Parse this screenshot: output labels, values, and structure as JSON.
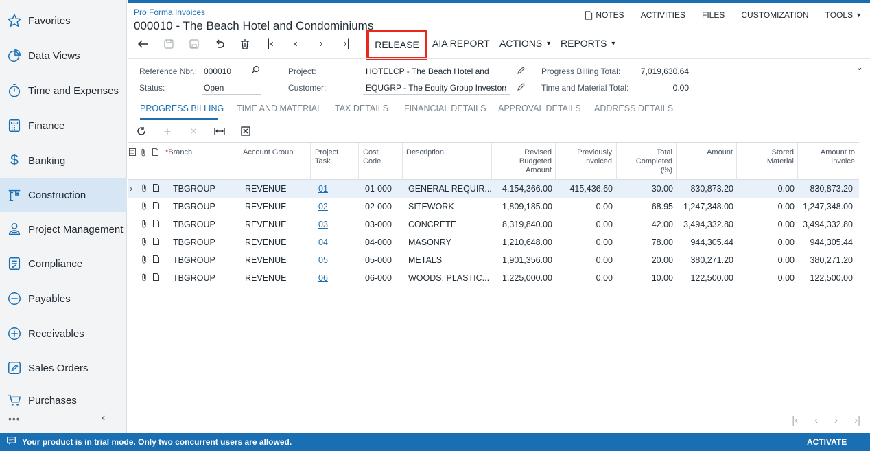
{
  "sidebar": {
    "items": [
      {
        "label": "Favorites",
        "icon": "star-icon"
      },
      {
        "label": "Data Views",
        "icon": "pie-chart-icon"
      },
      {
        "label": "Time and Expenses",
        "icon": "stopwatch-icon"
      },
      {
        "label": "Finance",
        "icon": "calculator-icon"
      },
      {
        "label": "Banking",
        "icon": "dollar-icon"
      },
      {
        "label": "Construction",
        "icon": "crane-icon"
      },
      {
        "label": "Project Management",
        "icon": "people-icon"
      },
      {
        "label": "Compliance",
        "icon": "checklist-icon"
      },
      {
        "label": "Payables",
        "icon": "minus-circle-icon"
      },
      {
        "label": "Receivables",
        "icon": "plus-circle-icon"
      },
      {
        "label": "Sales Orders",
        "icon": "edit-icon"
      },
      {
        "label": "Purchases",
        "icon": "cart-icon"
      }
    ],
    "more": "•••",
    "collapse": "‹"
  },
  "header": {
    "breadcrumb": "Pro Forma Invoices",
    "title": "000010 - The Beach Hotel and Condominiums",
    "links": {
      "notes": "NOTES",
      "activities": "ACTIVITIES",
      "files": "FILES",
      "customization": "CUSTOMIZATION",
      "tools": "TOOLS"
    }
  },
  "toolbar": {
    "release": "RELEASE",
    "aia_report": "AIA REPORT",
    "actions": "ACTIONS",
    "reports": "REPORTS"
  },
  "form": {
    "ref_label": "Reference Nbr.:",
    "ref_value": "000010",
    "status_label": "Status:",
    "status_value": "Open",
    "project_label": "Project:",
    "project_value": "HOTELCP - The Beach Hotel and Condo",
    "customer_label": "Customer:",
    "customer_value": "EQUGRP - The Equity Group Investors",
    "pb_total_label": "Progress Billing Total:",
    "pb_total_value": "7,019,630.64",
    "tm_total_label": "Time and Material Total:",
    "tm_total_value": "0.00"
  },
  "tabs": [
    "PROGRESS BILLING",
    "TIME AND MATERIAL",
    "TAX DETAILS",
    "FINANCIAL DETAILS",
    "APPROVAL DETAILS",
    "ADDRESS DETAILS"
  ],
  "grid": {
    "headers": {
      "branch": "Branch",
      "account_group": "Account Group",
      "project_task": "Project\nTask",
      "cost_code": "Cost\nCode",
      "description": "Description",
      "revised": "Revised\nBudgeted\nAmount",
      "previously": "Previously\nInvoiced",
      "total_completed": "Total\nCompleted\n(%)",
      "amount": "Amount",
      "stored": "Stored\nMaterial",
      "amount_to_invoice": "Amount to\nInvoice"
    },
    "rows": [
      {
        "branch": "TBGROUP",
        "account_group": "REVENUE",
        "task": "01",
        "cost_code": "01-000",
        "description": "GENERAL REQUIR...",
        "revised": "4,154,366.00",
        "previously": "415,436.60",
        "completed": "30.00",
        "amount": "830,873.20",
        "stored": "0.00",
        "to_invoice": "830,873.20"
      },
      {
        "branch": "TBGROUP",
        "account_group": "REVENUE",
        "task": "02",
        "cost_code": "02-000",
        "description": "SITEWORK",
        "revised": "1,809,185.00",
        "previously": "0.00",
        "completed": "68.95",
        "amount": "1,247,348.00",
        "stored": "0.00",
        "to_invoice": "1,247,348.00"
      },
      {
        "branch": "TBGROUP",
        "account_group": "REVENUE",
        "task": "03",
        "cost_code": "03-000",
        "description": "CONCRETE",
        "revised": "8,319,840.00",
        "previously": "0.00",
        "completed": "42.00",
        "amount": "3,494,332.80",
        "stored": "0.00",
        "to_invoice": "3,494,332.80"
      },
      {
        "branch": "TBGROUP",
        "account_group": "REVENUE",
        "task": "04",
        "cost_code": "04-000",
        "description": "MASONRY",
        "revised": "1,210,648.00",
        "previously": "0.00",
        "completed": "78.00",
        "amount": "944,305.44",
        "stored": "0.00",
        "to_invoice": "944,305.44"
      },
      {
        "branch": "TBGROUP",
        "account_group": "REVENUE",
        "task": "05",
        "cost_code": "05-000",
        "description": "METALS",
        "revised": "1,901,356.00",
        "previously": "0.00",
        "completed": "20.00",
        "amount": "380,271.20",
        "stored": "0.00",
        "to_invoice": "380,271.20"
      },
      {
        "branch": "TBGROUP",
        "account_group": "REVENUE",
        "task": "06",
        "cost_code": "06-000",
        "description": "WOODS, PLASTIC...",
        "revised": "1,225,000.00",
        "previously": "0.00",
        "completed": "10.00",
        "amount": "122,500.00",
        "stored": "0.00",
        "to_invoice": "122,500.00"
      }
    ]
  },
  "trial": {
    "message": "Your product is in trial mode. Only two concurrent users are allowed.",
    "activate": "ACTIVATE"
  },
  "colors": {
    "accent": "#1a6fb3",
    "highlight": "#e8281c",
    "active_nav": "#d6e6f4"
  }
}
